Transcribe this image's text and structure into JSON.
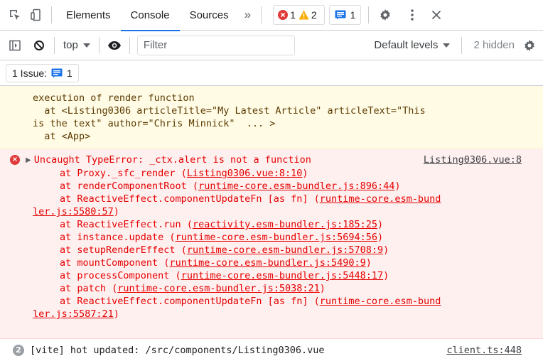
{
  "tabbar": {
    "tabs": [
      "Elements",
      "Console",
      "Sources"
    ],
    "active_tab": "Console",
    "more_tabs": "»",
    "error_count": "1",
    "warning_count": "2",
    "message_count": "1"
  },
  "toolbar": {
    "context": "top",
    "filter_placeholder": "Filter",
    "levels": "Default levels",
    "hidden": "2 hidden"
  },
  "issues": {
    "label": "1 Issue:",
    "count": "1"
  },
  "warning": {
    "lines": [
      "execution of render function",
      "  at <Listing0306 articleTitle=\"My Latest Article\" articleText=\"This",
      "is the text\" author=\"Chris Minnick\"  ... >",
      "  at <App>"
    ]
  },
  "error": {
    "message": "Uncaught TypeError: _ctx.alert is not a function",
    "source": "Listing0306.vue:8",
    "frames": [
      {
        "prefix": "at Proxy._sfc_render (",
        "link": "Listing0306.vue:8:10",
        "suffix": ")"
      },
      {
        "prefix": "at renderComponentRoot (",
        "link": "runtime-core.esm-bundler.js:896:44",
        "suffix": ")"
      },
      {
        "prefix": "at ReactiveEffect.componentUpdateFn [as fn] (",
        "link": "runtime-core.esm-bund",
        "suffix": ""
      },
      {
        "prefix": "",
        "link": "ler.js:5580:57",
        "suffix": ")",
        "wrap": true
      },
      {
        "prefix": "at ReactiveEffect.run (",
        "link": "reactivity.esm-bundler.js:185:25",
        "suffix": ")"
      },
      {
        "prefix": "at instance.update (",
        "link": "runtime-core.esm-bundler.js:5694:56",
        "suffix": ")"
      },
      {
        "prefix": "at setupRenderEffect (",
        "link": "runtime-core.esm-bundler.js:5708:9",
        "suffix": ")"
      },
      {
        "prefix": "at mountComponent (",
        "link": "runtime-core.esm-bundler.js:5490:9",
        "suffix": ")"
      },
      {
        "prefix": "at processComponent (",
        "link": "runtime-core.esm-bundler.js:5448:17",
        "suffix": ")"
      },
      {
        "prefix": "at patch (",
        "link": "runtime-core.esm-bundler.js:5038:21",
        "suffix": ")"
      },
      {
        "prefix": "at ReactiveEffect.componentUpdateFn [as fn] (",
        "link": "runtime-core.esm-bund",
        "suffix": ""
      },
      {
        "prefix": "",
        "link": "ler.js:5587:21",
        "suffix": ")",
        "wrap": true
      }
    ]
  },
  "info": {
    "repeat_count": "2",
    "message": "[vite] hot updated: /src/components/Listing0306.vue",
    "source": "client.ts:448"
  },
  "colors": {
    "accent": "#1a73e8",
    "error_text": "#e50000",
    "error_bg": "#fff0f0",
    "warning_bg": "#fffbe5",
    "warning_icon": "#f9ab00"
  }
}
